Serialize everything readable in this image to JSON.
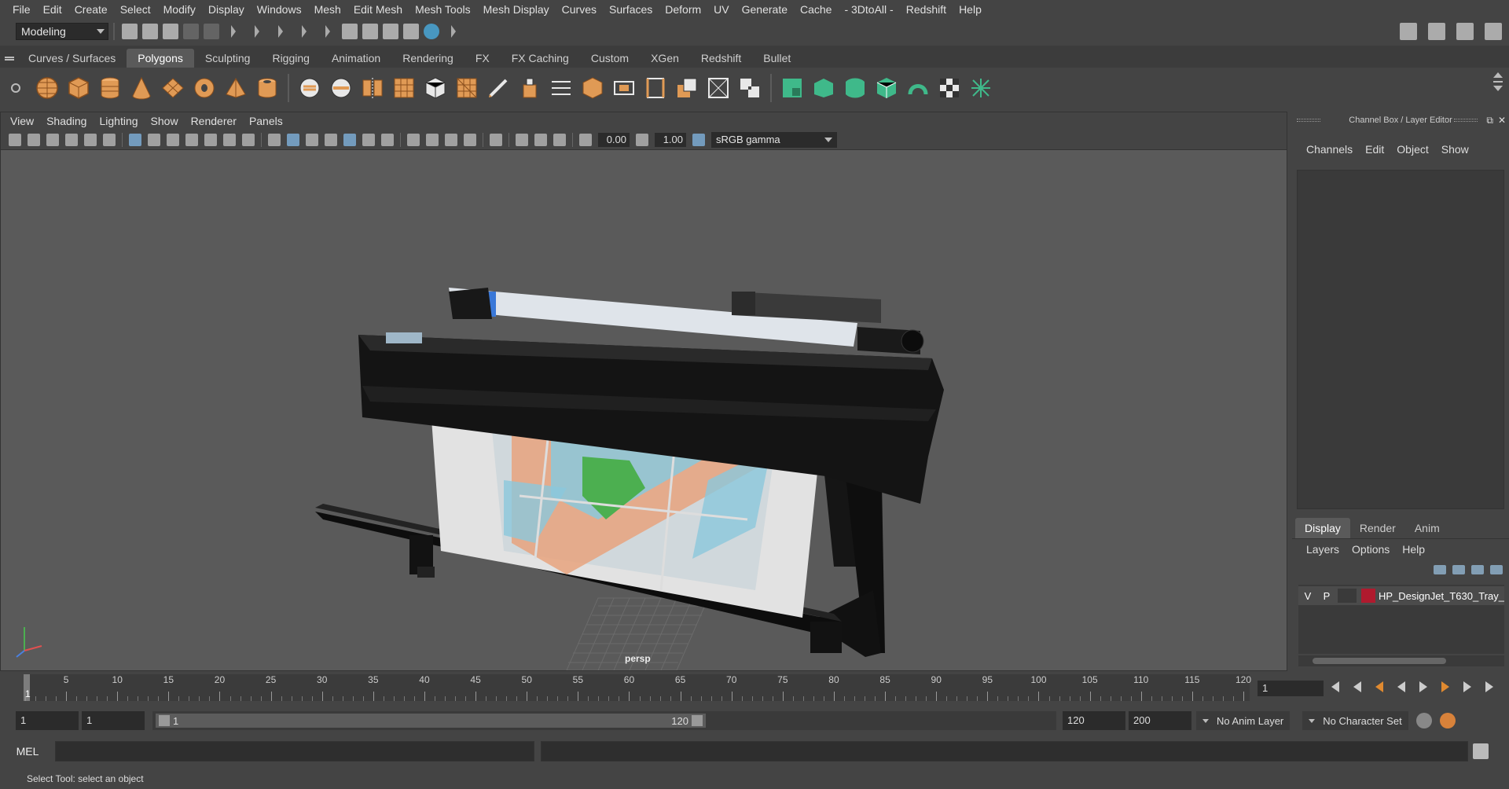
{
  "menubar": {
    "items": [
      "File",
      "Edit",
      "Create",
      "Select",
      "Modify",
      "Display",
      "Windows",
      "Mesh",
      "Edit Mesh",
      "Mesh Tools",
      "Mesh Display",
      "Curves",
      "Surfaces",
      "Deform",
      "UV",
      "Generate",
      "Cache",
      "- 3DtoAll -",
      "Redshift",
      "Help"
    ]
  },
  "statusline": {
    "mode": "Modeling"
  },
  "shelf": {
    "tabs": [
      "Curves / Surfaces",
      "Polygons",
      "Sculpting",
      "Rigging",
      "Animation",
      "Rendering",
      "FX",
      "FX Caching",
      "Custom",
      "XGen",
      "Redshift",
      "Bullet"
    ],
    "active_tab": "Polygons",
    "icon_colors": {
      "primitive": "#e09a55",
      "tool": "#e0a060",
      "green": "#3fb98a",
      "white": "#e8e8e8"
    }
  },
  "viewport": {
    "menu": [
      "View",
      "Shading",
      "Lighting",
      "Show",
      "Renderer",
      "Panels"
    ],
    "exposure": "0.00",
    "gamma": "1.00",
    "color_space": "sRGB gamma",
    "camera": "persp"
  },
  "channelbox": {
    "title": "Channel Box / Layer Editor",
    "menu": [
      "Channels",
      "Edit",
      "Object",
      "Show"
    ]
  },
  "layereditor": {
    "tabs": [
      "Display",
      "Render",
      "Anim"
    ],
    "active_tab": "Display",
    "menu": [
      "Layers",
      "Options",
      "Help"
    ],
    "layers": [
      {
        "visible": "V",
        "playback": "P",
        "color": "#b01a2e",
        "name": "HP_DesignJet_T630_Tray_"
      }
    ]
  },
  "timeslider": {
    "labels": [
      "5",
      "10",
      "15",
      "20",
      "25",
      "30",
      "35",
      "40",
      "45",
      "50",
      "55",
      "60",
      "65",
      "70",
      "75",
      "80",
      "85",
      "90",
      "95",
      "100",
      "105",
      "110",
      "115",
      "120"
    ],
    "current_label": "1",
    "current_frame": "1"
  },
  "rangeslider": {
    "start": "1",
    "anim_start": "1",
    "inner_start": "1",
    "inner_end": "120",
    "range_end": "120",
    "anim_end": "200",
    "anim_layer": "No Anim Layer",
    "character_set": "No Character Set"
  },
  "cmdline": {
    "label": "MEL"
  },
  "helpline": {
    "text": "Select Tool: select an object"
  }
}
